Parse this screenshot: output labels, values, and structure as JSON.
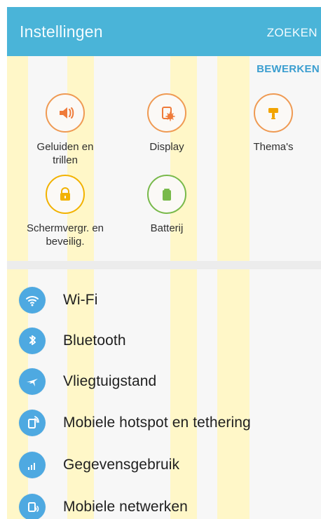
{
  "header": {
    "title": "Instellingen",
    "search_label": "ZOEKEN"
  },
  "actions": {
    "edit_label": "BEWERKEN"
  },
  "quick_settings": [
    {
      "label": "Geluiden en\ntrillen",
      "icon": "speaker-icon",
      "color": "#ef7b3a"
    },
    {
      "label": "Display",
      "icon": "display-settings-icon",
      "color": "#ef7b3a"
    },
    {
      "label": "Thema's",
      "icon": "paintbrush-icon",
      "color": "#f2a400"
    },
    {
      "label": "Schermvergr. en\nbeveilig.",
      "icon": "lock-icon",
      "color": "#f2b200"
    },
    {
      "label": "Batterij",
      "icon": "battery-icon",
      "color": "#78b94a"
    }
  ],
  "list_items": [
    {
      "label": "Wi-Fi",
      "icon": "wifi-icon"
    },
    {
      "label": "Bluetooth",
      "icon": "bluetooth-icon"
    },
    {
      "label": "Vliegtuigstand",
      "icon": "airplane-icon"
    },
    {
      "label": "Mobiele hotspot en tethering",
      "icon": "hotspot-icon"
    },
    {
      "label": "Gegevensgebruik",
      "icon": "data-usage-icon"
    },
    {
      "label": "Mobiele netwerken",
      "icon": "mobile-network-icon"
    }
  ],
  "colors": {
    "header": "#4ab4d8",
    "accent": "#3b9ed0",
    "list_icon": "#4ea9e1",
    "quick_orange": "#ef7b3a",
    "quick_yellow": "#f2b200",
    "quick_green": "#78b94a"
  }
}
